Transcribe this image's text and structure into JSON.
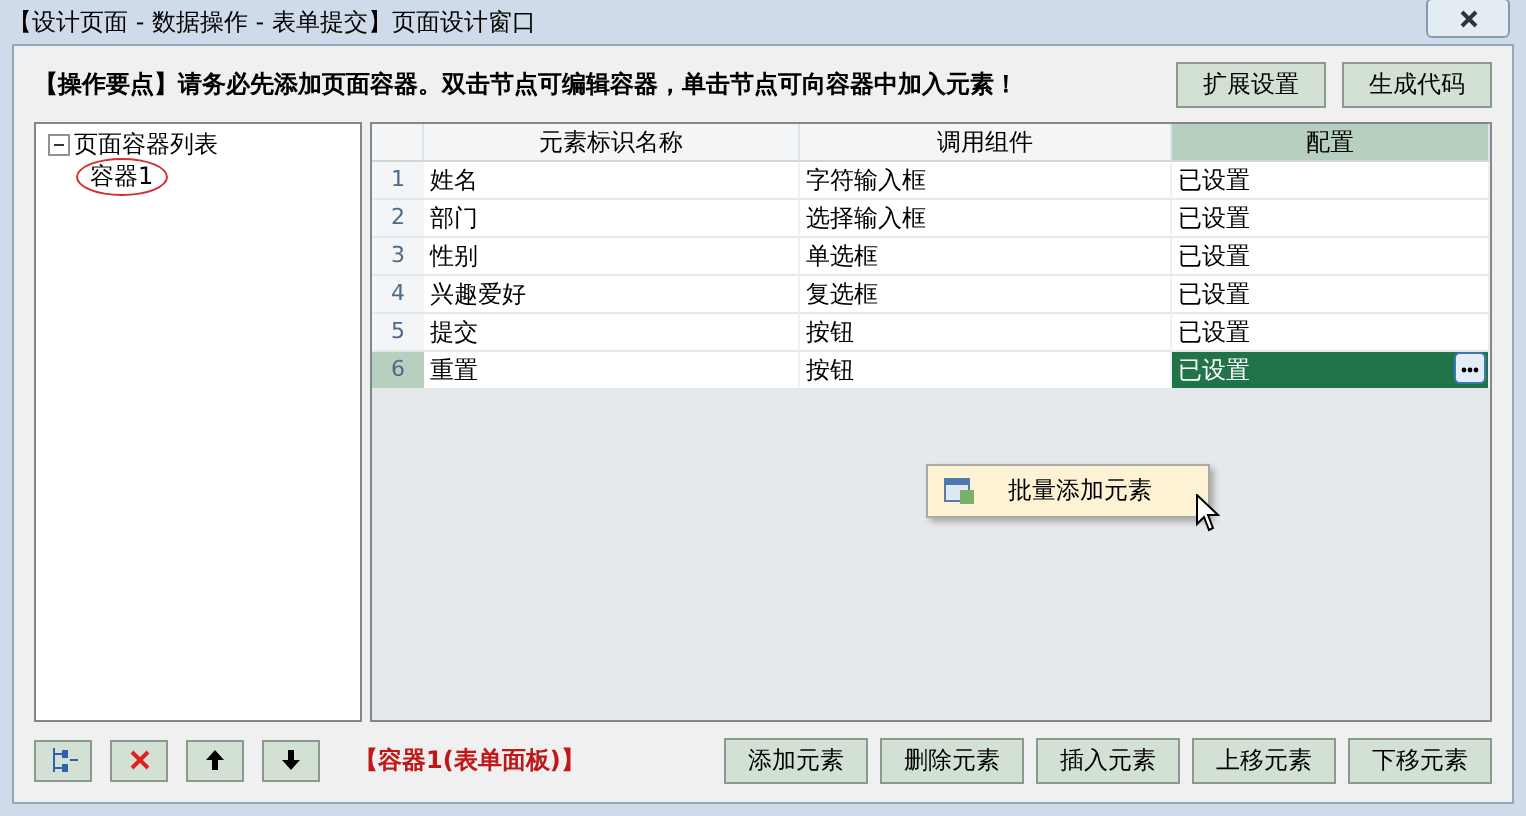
{
  "window": {
    "title": "【设计页面 - 数据操作 - 表单提交】页面设计窗口"
  },
  "hint": {
    "lead": "【操作要点】",
    "text": "请务必先添加页面容器。双击节点可编辑容器，单击节点可向容器中加入元素！"
  },
  "top_buttons": [
    "扩展设置",
    "生成代码"
  ],
  "tree": {
    "label": "页面容器列表",
    "expanded": true,
    "children": [
      {
        "label": "容器1",
        "circled": true
      }
    ]
  },
  "table": {
    "columns": [
      {
        "label": "元素标识名称",
        "selected": false
      },
      {
        "label": "调用组件",
        "selected": false
      },
      {
        "label": "配置",
        "selected": true
      }
    ],
    "rows": [
      {
        "index": "1",
        "name": "姓名",
        "component": "字符输入框",
        "config": "已设置",
        "selected": false
      },
      {
        "index": "2",
        "name": "部门",
        "component": "选择输入框",
        "config": "已设置",
        "selected": false
      },
      {
        "index": "3",
        "name": "性别",
        "component": "单选框",
        "config": "已设置",
        "selected": false
      },
      {
        "index": "4",
        "name": "兴趣爱好",
        "component": "复选框",
        "config": "已设置",
        "selected": false
      },
      {
        "index": "5",
        "name": "提交",
        "component": "按钮",
        "config": "已设置",
        "selected": false
      },
      {
        "index": "6",
        "name": "重置",
        "component": "按钮",
        "config": "已设置",
        "selected": true
      }
    ]
  },
  "context_menu": {
    "items": [
      "批量添加元素"
    ]
  },
  "status": "【容器1(表单面板)】",
  "bottom_buttons": [
    "添加元素",
    "删除元素",
    "插入元素",
    "上移元素",
    "下移元素"
  ]
}
